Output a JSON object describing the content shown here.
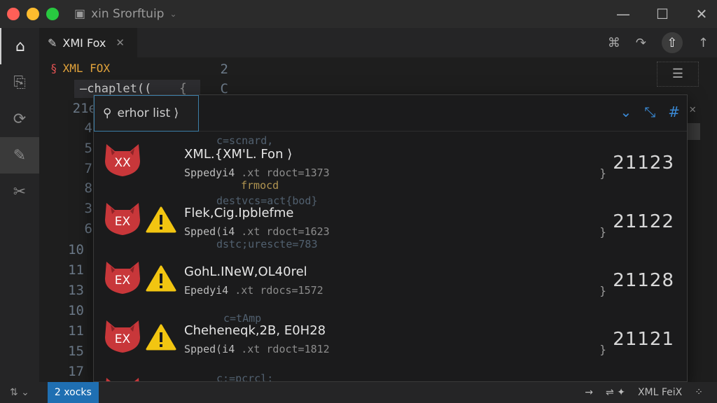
{
  "window": {
    "title": "xin Srorftuip",
    "controls": {
      "minimize": "—",
      "maximize": "☐",
      "close": "✕"
    }
  },
  "activity_bar": {
    "items": [
      {
        "icon": "home-icon",
        "glyph": "⌂"
      },
      {
        "icon": "file-transfer-icon",
        "glyph": "⎘"
      },
      {
        "icon": "sync-icon",
        "glyph": "⟳"
      },
      {
        "icon": "fox-extension-icon",
        "glyph": "✎"
      },
      {
        "icon": "tools-icon",
        "glyph": "✂"
      }
    ]
  },
  "tabs": [
    {
      "label": "XMI Fox",
      "close": "✕"
    }
  ],
  "tab_actions": {
    "a": "⌘",
    "b": "↷",
    "c": "⇧",
    "d": "↑"
  },
  "editor": {
    "file_label": "XML FOX",
    "code_line": "—chaplet((",
    "brace": "{",
    "gutter": [
      "2",
      "C",
      "21e",
      "4",
      "5",
      "7",
      "8",
      "3",
      "6",
      "10",
      "11",
      "13",
      "10",
      "11",
      "15",
      "17"
    ],
    "close_x": "✕"
  },
  "panel": {
    "search_value": "erhor list ⟩",
    "rows": [
      {
        "title": "XML.{XM'L. Fon ⟩",
        "sub_a": "Sppedyi4",
        "sub_b": ".xt rdoct=1373",
        "brace": "}",
        "number": "21123",
        "fox_label": "XX",
        "warning": false
      },
      {
        "title": "Flek,Cig.Ipblefme",
        "sub_a": "Spped⟨i4",
        "sub_b": ".xt rdoct=1623",
        "brace": "}",
        "number": "21122",
        "fox_label": "EX",
        "warning": true
      },
      {
        "title": "GohL.INeW,OL40rel",
        "sub_a": "Epedyi4",
        "sub_b": ".xt rdocs=1572",
        "brace": "}",
        "number": "21128",
        "fox_label": "EX",
        "warning": true
      },
      {
        "title": "Cheheneqk,2B, E0H28",
        "sub_a": "Spped⟨i4",
        "sub_b": ".xt rdoct=1812",
        "brace": "}",
        "number": "21121",
        "fox_label": "EX",
        "warning": true
      }
    ],
    "ghost_code": [
      "c=scnard,",
      "frmocd",
      "destvcs=act{bod}",
      "dstc;urescte=783",
      "c=tAmp",
      "c:=pcrcl;"
    ]
  },
  "statusbar": {
    "left": "⇅ ⌄",
    "badge": "2 xocks",
    "right_items": [
      "→",
      "⇌ ✦",
      "XML FeiX",
      "⁘"
    ]
  },
  "colors": {
    "accent": "#1f6fb2",
    "fox_red": "#c8373a",
    "warning_yellow": "#f2c511",
    "label_orange": "#e2a33b"
  }
}
